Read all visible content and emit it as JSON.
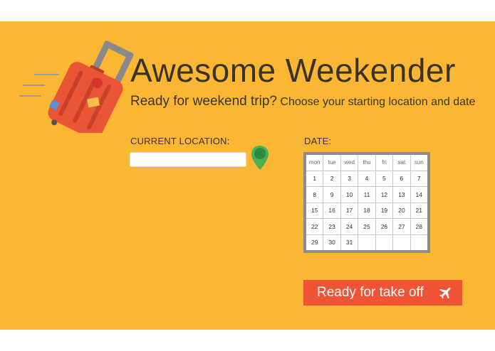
{
  "header": {
    "title": "Awesome Weekender",
    "subtitle_lead": "Ready for weekend trip?",
    "subtitle_rest": "Choose your starting location and date"
  },
  "location": {
    "label": "CURRENT LOCATION:",
    "value": "",
    "placeholder": ""
  },
  "date": {
    "label": "DATE:",
    "weekdays": [
      "mon",
      "tue",
      "wed",
      "thu",
      "fri",
      "sat",
      "sun"
    ],
    "days": [
      [
        "1",
        "2",
        "3",
        "4",
        "5",
        "6",
        "7"
      ],
      [
        "8",
        "9",
        "10",
        "11",
        "12",
        "13",
        "14"
      ],
      [
        "15",
        "16",
        "17",
        "18",
        "19",
        "20",
        "21"
      ],
      [
        "22",
        "23",
        "24",
        "25",
        "26",
        "27",
        "28"
      ],
      [
        "29",
        "30",
        "31",
        "",
        "",
        "",
        ""
      ]
    ]
  },
  "submit": {
    "label": "Ready for take off",
    "icon": "airplane-icon"
  },
  "icons": {
    "logo": "suitcase-icon",
    "location": "map-pin-icon"
  },
  "colors": {
    "background": "#fbb734",
    "text": "#3b3326",
    "button": "#f05437",
    "pin": "#4caf50",
    "suitcase": "#ea5535"
  }
}
